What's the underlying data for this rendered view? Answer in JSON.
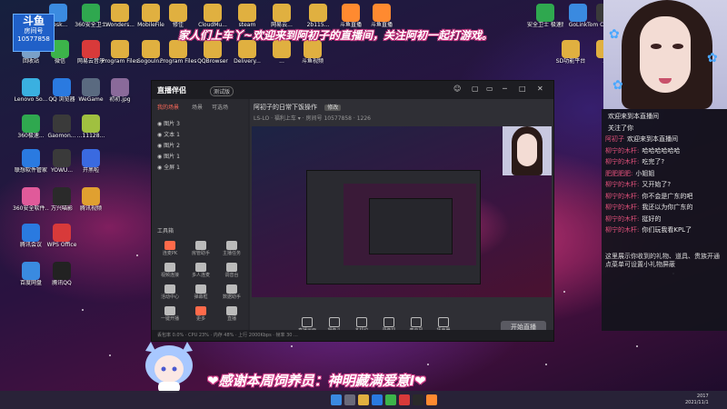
{
  "badge": {
    "logo": "斗鱼",
    "room_label": "房间号",
    "room_number": "10577858"
  },
  "welcome_text": "家人们上车丫~欢迎来到阿初子的直播间，关注阿初一起打游戏。",
  "desktop_icons": [
    {
      "label": "Desk...",
      "color": "#3b8be0"
    },
    {
      "label": "360安全卫士",
      "color": "#2fa84f"
    },
    {
      "label": "Wonders...",
      "color": "#e0b040"
    },
    {
      "label": "MobileFile",
      "color": "#e0b040"
    },
    {
      "label": "修佳",
      "color": "#e0b040"
    },
    {
      "label": "CloudMu...",
      "color": "#e0b040"
    },
    {
      "label": "steam",
      "color": "#e0b040"
    },
    {
      "label": "网易云...",
      "color": "#e0b040"
    },
    {
      "label": "2b115...",
      "color": "#e0b040"
    },
    {
      "label": "斗鱼直播",
      "color": "#ff8a30"
    },
    {
      "label": "斗鱼直播",
      "color": "#ff8a30"
    },
    {
      "label": "回收站",
      "color": "#7aa0c8"
    },
    {
      "label": "微信",
      "color": "#3cb44a"
    },
    {
      "label": "网易云音乐",
      "color": "#d83a3a"
    },
    {
      "label": "Program Files (x86)",
      "color": "#e0b040"
    },
    {
      "label": "SogouIn...",
      "color": "#e0b040"
    },
    {
      "label": "Program Files",
      "color": "#e0b040"
    },
    {
      "label": "QQBrowser",
      "color": "#e0b040"
    },
    {
      "label": "Delivery...",
      "color": "#e0b040"
    },
    {
      "label": "...",
      "color": "#e0b040"
    },
    {
      "label": "斗鱼视频",
      "color": "#e0b040"
    },
    {
      "label": "Lenovo So...",
      "color": "#3ab0e0"
    },
    {
      "label": "QQ 浏览器",
      "color": "#2a7ae0"
    },
    {
      "label": "WeGame",
      "color": "#5a6a80"
    },
    {
      "label": "初初.jpg",
      "color": "#8a6a9a"
    },
    {
      "label": "360极速...",
      "color": "#2fa84f"
    },
    {
      "label": "Gaomon...",
      "color": "#3a3a3a"
    },
    {
      "label": "...11128...",
      "color": "#a0c040"
    },
    {
      "label": "联想软件管家",
      "color": "#2a7ae0"
    },
    {
      "label": "YOWU...",
      "color": "#3a3a3a"
    },
    {
      "label": "开黑啦",
      "color": "#3a6ae0"
    },
    {
      "label": "360安全软件...",
      "color": "#e05a9a"
    },
    {
      "label": "万兴喵影",
      "color": "#2a2a2a"
    },
    {
      "label": "腾讯视频",
      "color": "#e0a030"
    },
    {
      "label": "腾讯会议",
      "color": "#2a7ae0"
    },
    {
      "label": "WPS Office",
      "color": "#d83a3a"
    },
    {
      "label": "百度网盘",
      "color": "#3a8ae0"
    },
    {
      "label": "腾讯QQ",
      "color": "#222222"
    },
    {
      "label": "GoLink",
      "color": "#3a8ae0"
    },
    {
      "label": "Tom Clancy's...",
      "color": "#3a3a3a"
    },
    {
      "label": "安全卫士 极速版",
      "color": "#2fa84f"
    },
    {
      "label": "SD功能平台",
      "color": "#e0b040"
    },
    {
      "label": "...",
      "color": "#e0b040"
    }
  ],
  "chat": {
    "messages": [
      {
        "name": "",
        "text": "欢迎来到本直播间"
      },
      {
        "name": "",
        "text": "关注了你"
      },
      {
        "name": "阿初子",
        "text": "欢迎来到本直播间"
      },
      {
        "name": "柳宁的木杆:",
        "text": "哈哈哈哈哈哈"
      },
      {
        "name": "柳宁的木杆:",
        "text": "吃完了?"
      },
      {
        "name": "肥肥肥肥:",
        "text": "小姐姐"
      },
      {
        "name": "柳宁的木杆:",
        "text": "又开始了?"
      },
      {
        "name": "柳宁的木杆:",
        "text": "你不会是广东的吧"
      },
      {
        "name": "柳宁的木杆:",
        "text": "我还以为你广东的"
      },
      {
        "name": "柳宁的木杆:",
        "text": "挺好的"
      },
      {
        "name": "柳宁的木杆:",
        "text": "你们玩我看KPL了"
      }
    ],
    "note": "这里展示你收到的礼物、道具、贵族开通 点菜单可设置小礼物屏蔽"
  },
  "app": {
    "title": "直播伴侣",
    "version": "测试版",
    "window_controls": [
      "☺",
      "▢",
      "▭",
      "─",
      "□",
      "✕"
    ],
    "side_tabs": [
      "我的场景",
      "场景",
      "可选场"
    ],
    "layers": [
      "图片 3",
      "文本 1",
      "图片 2",
      "图片 1",
      "全屏 1"
    ],
    "tools_heading": "工具箱",
    "tools": [
      "连麦PK",
      "房管助手",
      "主播任务",
      "视频连接",
      "多人连麦",
      "调音台",
      "活动中心",
      "弹幕框",
      "数据助手",
      "一键开播",
      "更多",
      "直播"
    ],
    "room_title": "阿初子的日常下饭操作",
    "room_tag": "修改",
    "room_meta": "LS-LO  ·  福利上车 ▾  ·  房间号 10577858  ·  1226",
    "bottom_buttons": [
      "直播画面",
      "摄像头",
      "多机位",
      "录像机",
      "麦克风",
      "扬声器"
    ],
    "go_live": "开始直播",
    "status_text": "丢包率 0.0%  ·  CPU 23%  ·  内存 48%  ·  上行 2000Kbps  ·  帧率 30 ..."
  },
  "thanks_text": "❤感谢本周饲养员：神明藏满爱意I❤",
  "tray": {
    "time": "2017",
    "date": "2021/11/1"
  }
}
